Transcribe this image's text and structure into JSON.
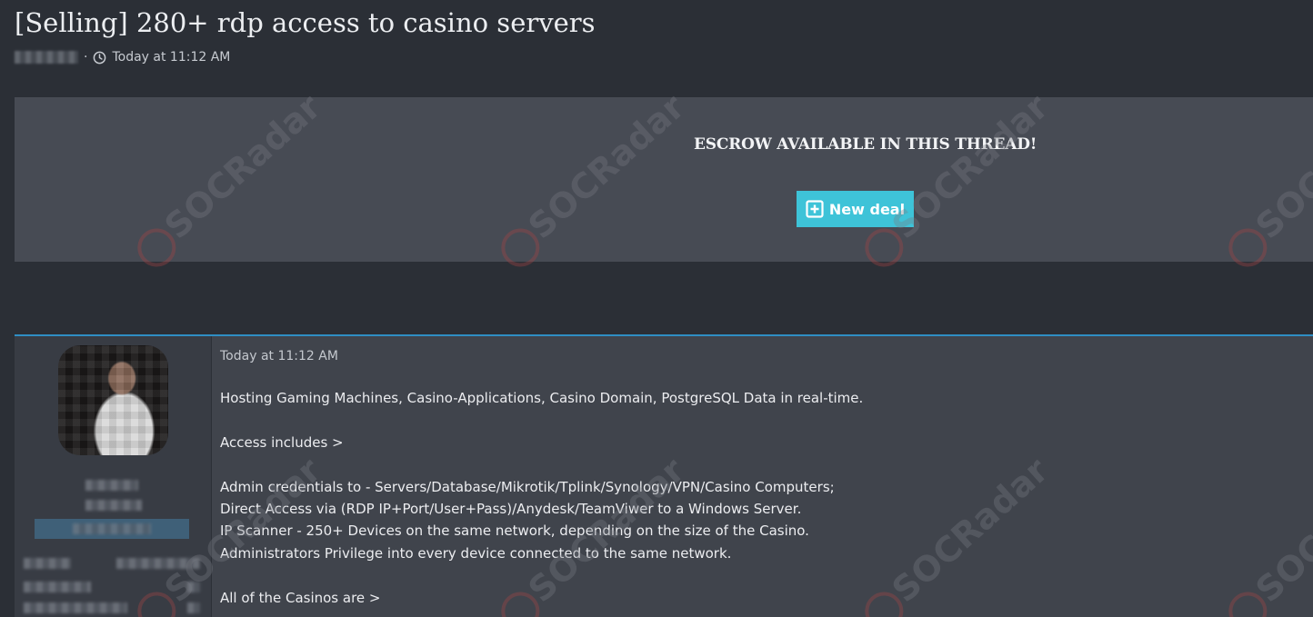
{
  "thread": {
    "title": "[Selling] 280+ rdp access to casino servers",
    "meta_separator": "·",
    "posted_time": "Today at 11:12 AM"
  },
  "escrow": {
    "notice": "ESCROW AVAILABLE IN THIS THREAD!",
    "new_deal_label": "New deal"
  },
  "post": {
    "time": "Today at 11:12 AM",
    "lines": {
      "l1": "Hosting Gaming Machines, Casino-Applications, Casino Domain, PostgreSQL Data in real-time.",
      "l2": "Access includes >",
      "l3": "Admin credentials to - Servers/Database/Mikrotik/Tplink/Synology/VPN/Casino Computers;",
      "l4": "Direct Access via (RDP IP+Port/User+Pass)/Anydesk/TeamViwer to a Windows Server.",
      "l5": "IP Scanner - 250+ Devices on the same network, depending on the size of the Casino.",
      "l6": "Administrators Privilege into every device connected to the same network.",
      "l7": "All of the Casinos are >"
    }
  },
  "watermark": {
    "text": "SOCRadar"
  },
  "icons": {
    "clock": "clock-icon",
    "plus": "plus-square-icon"
  },
  "colors": {
    "accent": "#3ec3d8",
    "post_border": "#2f8ec4",
    "background": "#2b2f36"
  }
}
